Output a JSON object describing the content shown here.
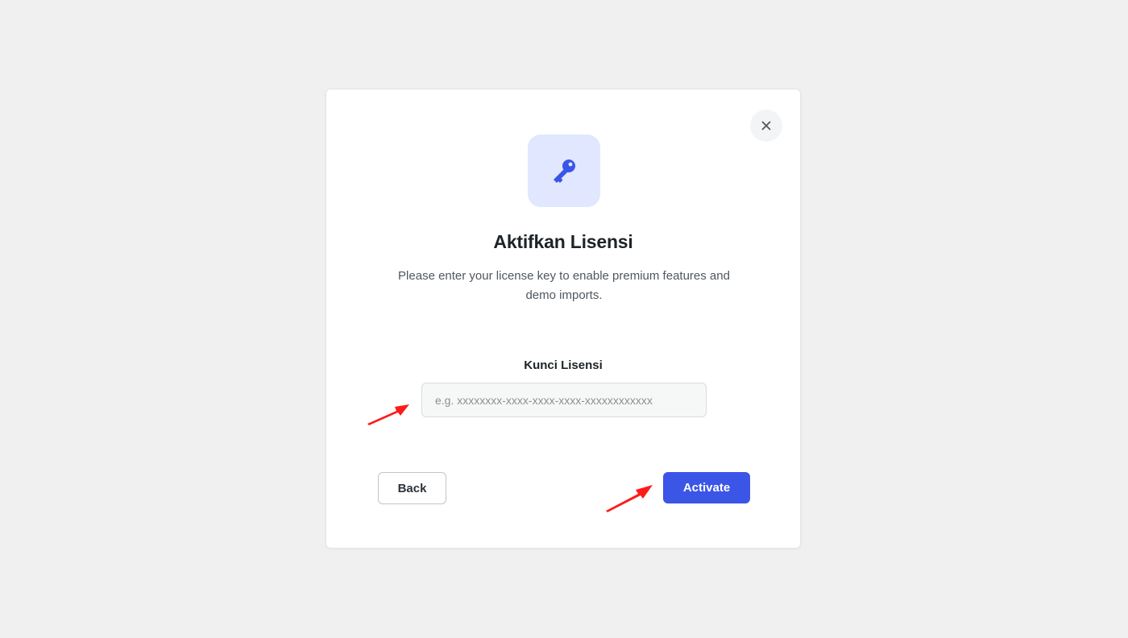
{
  "modal": {
    "close_icon": "close-icon",
    "badge_icon": "key-icon",
    "title": "Aktifkan Lisensi",
    "description": "Please enter your license key to enable premium features and demo imports.",
    "field_label": "Kunci Lisensi",
    "input_placeholder": "e.g. xxxxxxxx-xxxx-xxxx-xxxx-xxxxxxxxxxxx",
    "input_value": "",
    "back_label": "Back",
    "activate_label": "Activate"
  },
  "annotations": {
    "arrow_color": "#ff1a1a",
    "arrows": [
      "annotation-arrow-input",
      "annotation-arrow-activate"
    ]
  },
  "colors": {
    "page_background": "#f0f0f1",
    "accent": "#3b55e6",
    "badge_background": "#e0e7ff"
  }
}
